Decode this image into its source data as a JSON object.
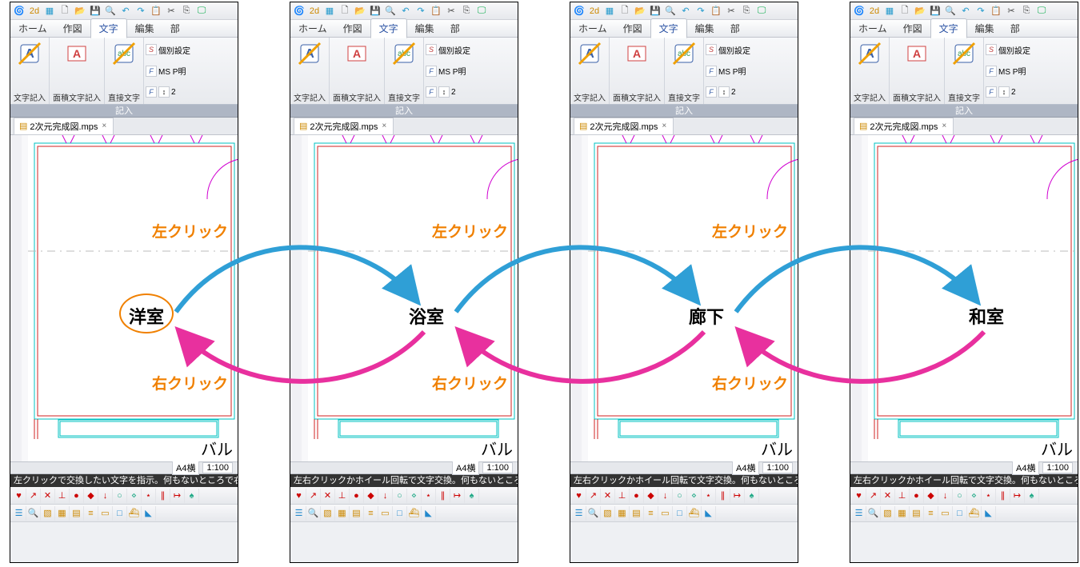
{
  "menu": {
    "items": [
      "ホーム",
      "作図",
      "文字",
      "編集",
      "部"
    ],
    "active_index": 2
  },
  "ribbon": {
    "groups": [
      {
        "label": "文字記入"
      },
      {
        "label": "面積文字記入"
      },
      {
        "label": "直接文字"
      }
    ],
    "side": {
      "row1": "個別設定",
      "row2": "MS P明",
      "row3_value": "2"
    },
    "title": "記入"
  },
  "file_tab": {
    "name": "2次元完成図.mps",
    "close": "×"
  },
  "frames": [
    {
      "room_label": "洋室",
      "circled": true,
      "hint": "左クリックで交換したい文字を指示。何もないところで右クリック"
    },
    {
      "room_label": "浴室",
      "circled": false,
      "hint": "左右クリックかホイール回転で文字交換。何もないところで右ク"
    },
    {
      "room_label": "廊下",
      "circled": false,
      "hint": "左右クリックかホイール回転で文字交換。何もないところで右ク"
    },
    {
      "room_label": "和室",
      "circled": false,
      "hint": "左右クリックかホイール回転で文字交換。何もないところで右ク"
    }
  ],
  "corner_label": "バル",
  "status": {
    "paper": "A4横",
    "scale": "1:100"
  },
  "annotations": {
    "left_click": "左クリック",
    "right_click": "右クリック"
  },
  "colors": {
    "arrow_blue": "#2f9fd6",
    "arrow_pink": "#e8309e",
    "orange": "#f08000"
  },
  "icons": {
    "logo": "logo-icon",
    "mode": "2d3d-icon",
    "new": "new-doc-icon",
    "open": "open-folder-icon",
    "save": "save-icon",
    "search": "search-icon",
    "undo": "undo-icon",
    "redo": "redo-icon",
    "paste": "paste-icon",
    "copy": "copy-icon",
    "monitor": "monitor-icon",
    "ribbon_text": "text-input-icon",
    "ribbon_area": "area-text-icon",
    "ribbon_direct": "direct-text-icon",
    "style_s": "style-s-icon",
    "style_f": "font-f-icon",
    "style_a": "attr-a-icon"
  }
}
